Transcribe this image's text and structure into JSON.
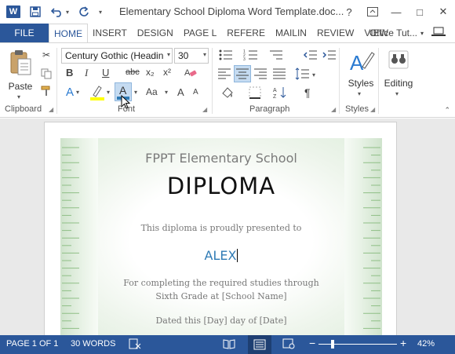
{
  "titlebar": {
    "app_icon_letter": "W",
    "title": "Elementary School Diploma Word Template.doc...",
    "help": "?",
    "minimize": "—",
    "restore": "□",
    "close": "✕"
  },
  "tabs": {
    "file": "FILE",
    "items": [
      "HOME",
      "INSERT",
      "DESIGN",
      "PAGE L",
      "REFERE",
      "MAILIN",
      "REVIEW",
      "VIEW"
    ],
    "user": "Office Tut..."
  },
  "ribbon": {
    "clipboard": {
      "paste": "Paste",
      "label": "Clipboard"
    },
    "font": {
      "name": "Century Gothic (Headin",
      "size": "30",
      "label": "Font",
      "bold": "B",
      "italic": "I",
      "underline": "U",
      "strike": "abc",
      "subscript": "x₂",
      "superscript": "x²",
      "text_effects": "A",
      "font_color": "A",
      "grow": "A",
      "shrink": "A",
      "change_case": "Aa"
    },
    "paragraph": {
      "label": "Paragraph",
      "pilcrow": "¶"
    },
    "styles": {
      "label": "Styles",
      "button": "Styles"
    },
    "editing": {
      "button": "Editing"
    },
    "colors": {
      "highlight": "#ffff00",
      "font_color": "#2f7bb5",
      "accent": "#2b579a"
    }
  },
  "document": {
    "school": "FPPT Elementary School",
    "diploma": "DIPLOMA",
    "presented": "This diploma is proudly presented to",
    "name": "ALEX",
    "line1": "For completing the required studies through",
    "line2": "Sixth Grade at [School Name]",
    "dated": "Dated this [Day] day of [Date]"
  },
  "status": {
    "page": "PAGE 1 OF 1",
    "words": "30 WORDS",
    "zoom": "42%",
    "zoom_minus": "−",
    "zoom_plus": "+",
    "zoom_level": 0.42
  }
}
